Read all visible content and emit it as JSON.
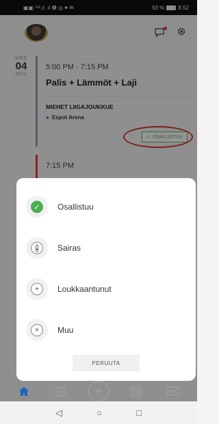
{
  "status_bar": {
    "left_text": "▣▣ ⁴ᴳ.ıl .ıl ❻ ◎ ♥ ✉",
    "battery_text": "93 %",
    "time": "8.52"
  },
  "event": {
    "weekday": "WED",
    "day": "04",
    "month": "NOV",
    "time": "5:00 PM - 7:15 PM",
    "title": "Palis + Lämmöt + Laji",
    "group": "MIEHET LIIGAJOUKKUE",
    "location": "Espot Arena",
    "status": "OSALLISTUU"
  },
  "event2": {
    "time": "7:15 PM"
  },
  "sheet": {
    "options": [
      {
        "label": "Osallistuu",
        "icon": "check-icon"
      },
      {
        "label": "Sairas",
        "icon": "thermometer-icon"
      },
      {
        "label": "Loukkaantunut",
        "icon": "plus-icon"
      },
      {
        "label": "Muu",
        "icon": "x-icon"
      }
    ],
    "cancel_label": "PERUUTA"
  },
  "tabs": [
    "home-icon",
    "calendar-icon",
    "add-icon",
    "calendar-grid-icon",
    "chart-icon"
  ],
  "colors": {
    "accent_green": "#4caf50",
    "nav_blue": "#1565c0",
    "annotation_red": "#d33333"
  }
}
